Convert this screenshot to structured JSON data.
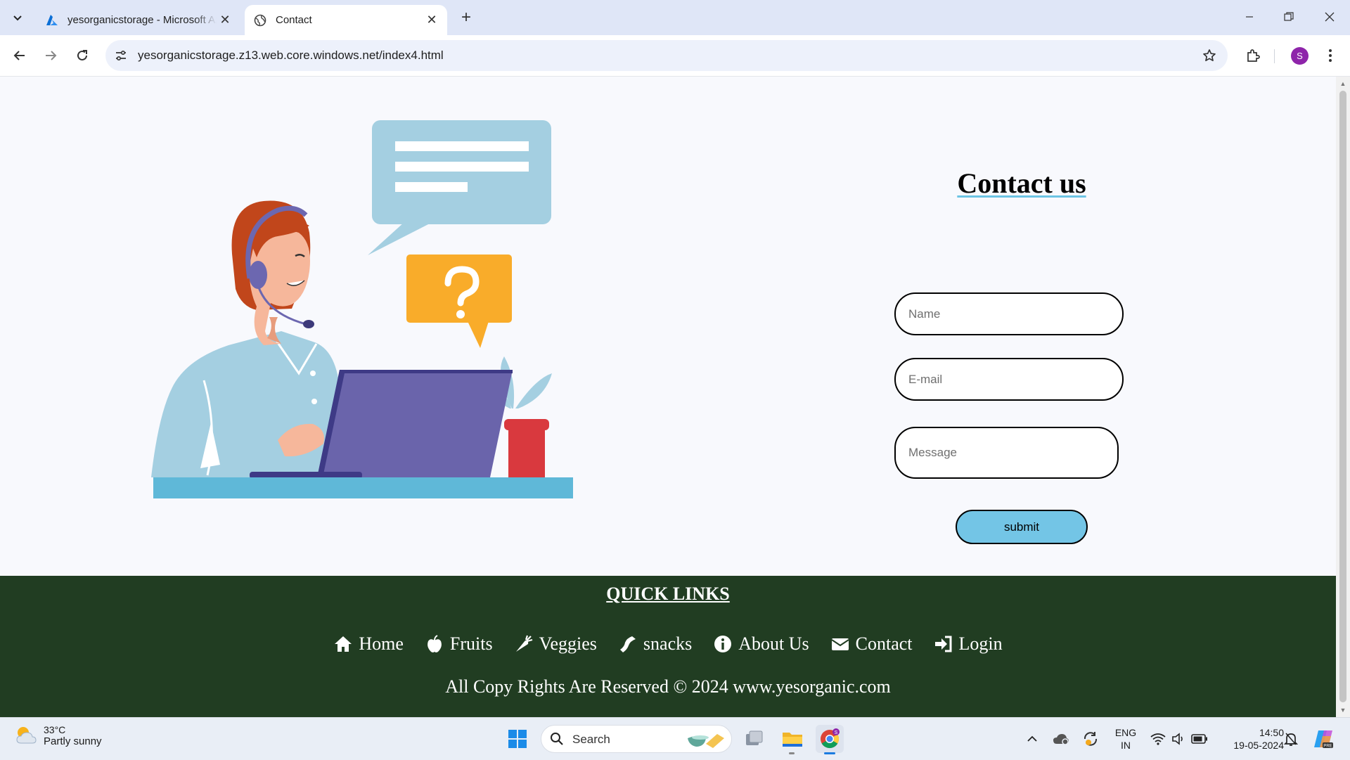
{
  "browser": {
    "tabs": [
      {
        "title": "yesorganicstorage - Microsoft Azure",
        "active": false
      },
      {
        "title": "Contact",
        "active": true
      }
    ],
    "url": "yesorganicstorage.z13.web.core.windows.net/index4.html",
    "profile_initial": "S"
  },
  "contact": {
    "title": "Contact us",
    "name_placeholder": "Name",
    "email_placeholder": "E-mail",
    "message_placeholder": "Message",
    "submit_label": "submit"
  },
  "footer": {
    "heading": "QUICK LINKS",
    "links": [
      {
        "label": "Home",
        "icon": "home-icon"
      },
      {
        "label": "Fruits",
        "icon": "apple-icon"
      },
      {
        "label": "Veggies",
        "icon": "carrot-icon"
      },
      {
        "label": "snacks",
        "icon": "bacon-icon"
      },
      {
        "label": "About Us",
        "icon": "info-icon"
      },
      {
        "label": "Contact",
        "icon": "envelope-icon"
      },
      {
        "label": "Login",
        "icon": "sign-in-icon"
      }
    ],
    "copyright": "All Copy Rights Are Reserved © 2024 www.yesorganic.com"
  },
  "taskbar": {
    "temperature": "33°C",
    "weather": "Partly sunny",
    "search_label": "Search",
    "language": "ENG",
    "region": "IN",
    "time": "14:50",
    "date": "19-05-2024"
  },
  "colors": {
    "footer_bg": "#213d22",
    "submit_bg": "#73c5e6",
    "title_underline": "#6cc4e4"
  }
}
